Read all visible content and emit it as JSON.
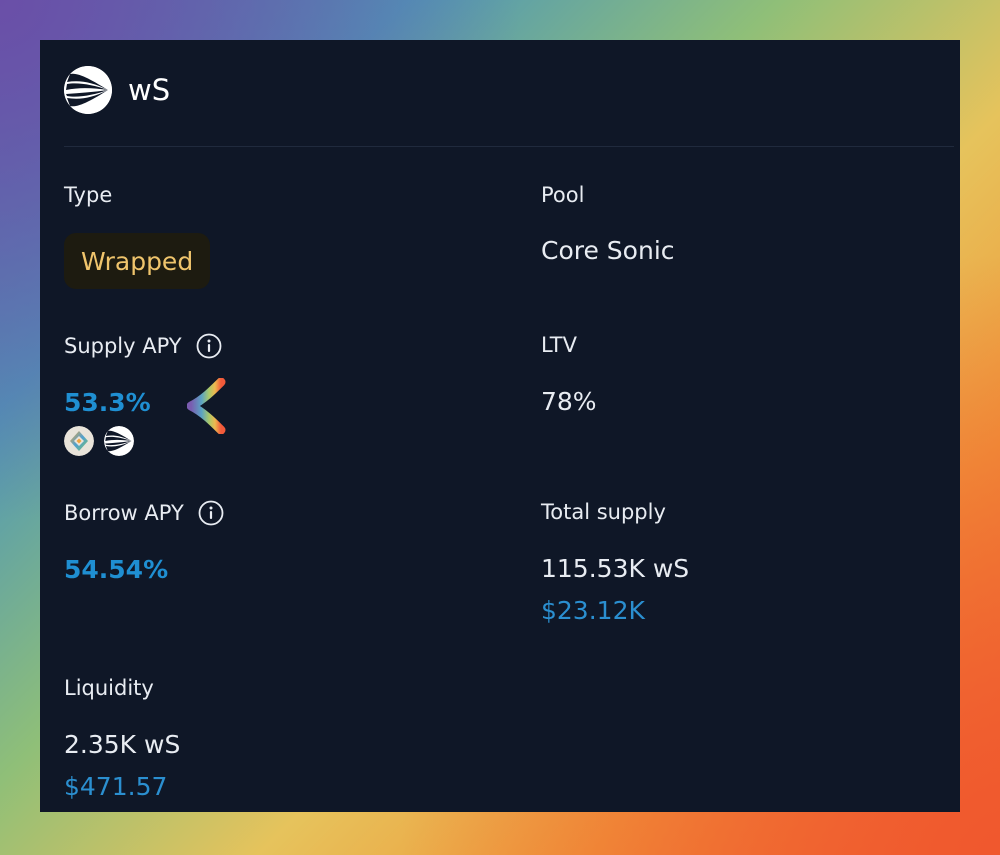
{
  "token": {
    "name": "wS",
    "logo_icon": "sonic-logo-icon"
  },
  "details": {
    "type": {
      "label": "Type",
      "value": "Wrapped"
    },
    "pool": {
      "label": "Pool",
      "value": "Core Sonic"
    },
    "supply_apy": {
      "label": "Supply APY",
      "value": "53.3%",
      "reward_icons": [
        "reward-token-icon",
        "sonic-logo-icon"
      ]
    },
    "ltv": {
      "label": "LTV",
      "value": "78%"
    },
    "borrow_apy": {
      "label": "Borrow APY",
      "value": "54.54%"
    },
    "total_supply": {
      "label": "Total supply",
      "value": "115.53K wS",
      "usd": "$23.12K"
    },
    "liquidity": {
      "label": "Liquidity",
      "value": "2.35K wS",
      "usd": "$471.57"
    }
  },
  "colors": {
    "card_bg": "#0f1727",
    "accent_blue": "#1f8fd2",
    "badge_bg": "#1d1b10",
    "badge_text": "#efc46c"
  }
}
